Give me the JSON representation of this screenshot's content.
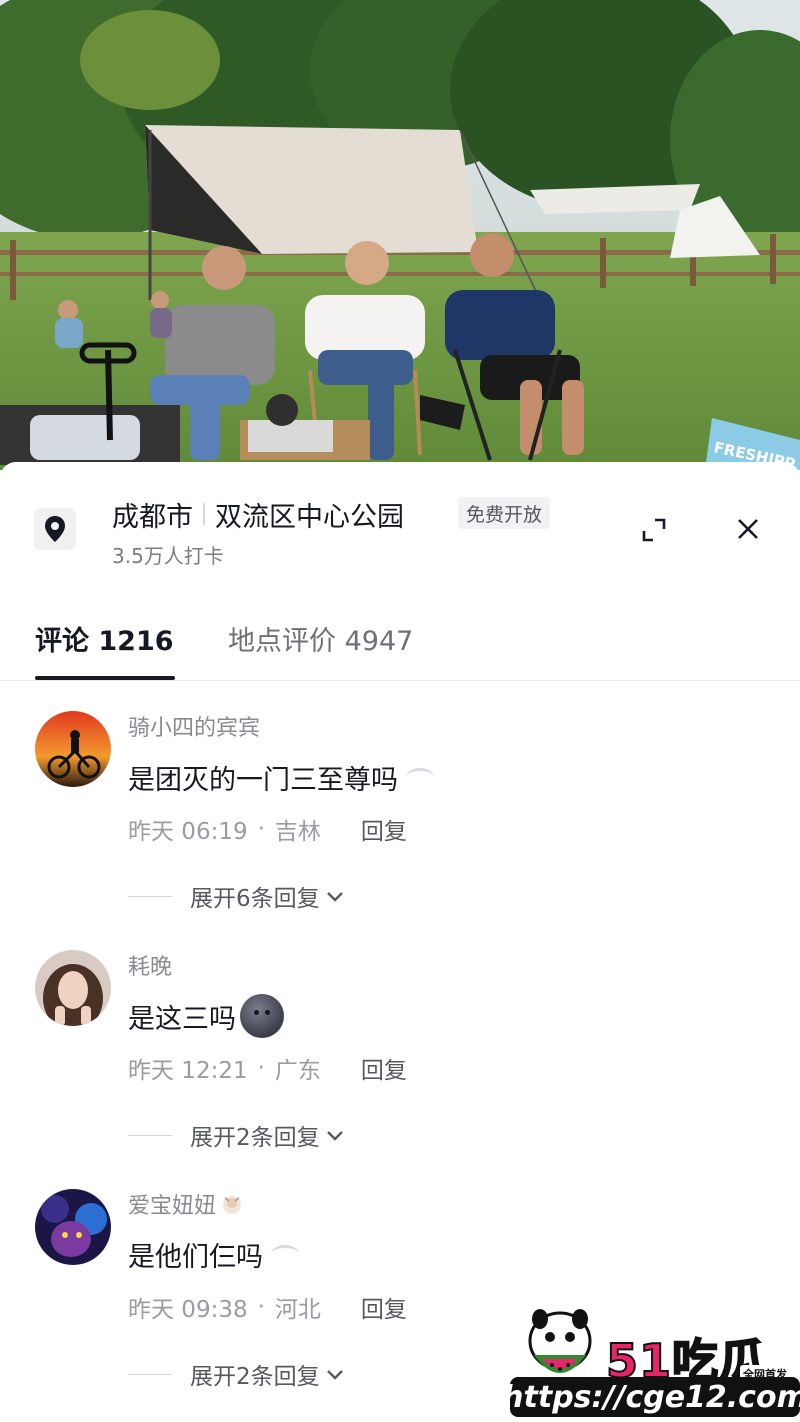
{
  "location": {
    "city": "成都市",
    "place": "双流区中心公园",
    "badge": "免费开放",
    "checkins": "3.5万人打卡",
    "icon": "location-pin-icon"
  },
  "tabs": [
    {
      "label": "评论 1216",
      "active": true
    },
    {
      "label": "地点评价 4947",
      "active": false
    }
  ],
  "comments": [
    {
      "user": "骑小四的宾宾",
      "text": "是团灭的一门三至尊吗",
      "time": "昨天 06:19",
      "region": "吉林",
      "reply_label": "回复",
      "expand_label": "展开6条回复"
    },
    {
      "user": "耗晚",
      "text": "是这三吗",
      "time": "昨天 12:21",
      "region": "广东",
      "reply_label": "回复",
      "expand_label": "展开2条回复"
    },
    {
      "user": "爱宝妞妞",
      "text": "是他们仨吗",
      "time": "昨天 09:38",
      "region": "河北",
      "reply_label": "回复",
      "expand_label": "展开2条回复"
    }
  ],
  "meta_separator": "·",
  "watermark": {
    "brand": "51吃瓜",
    "tag": "全网首发",
    "url": "https://cge12.com"
  },
  "photo_sign": "FRESHIPP"
}
